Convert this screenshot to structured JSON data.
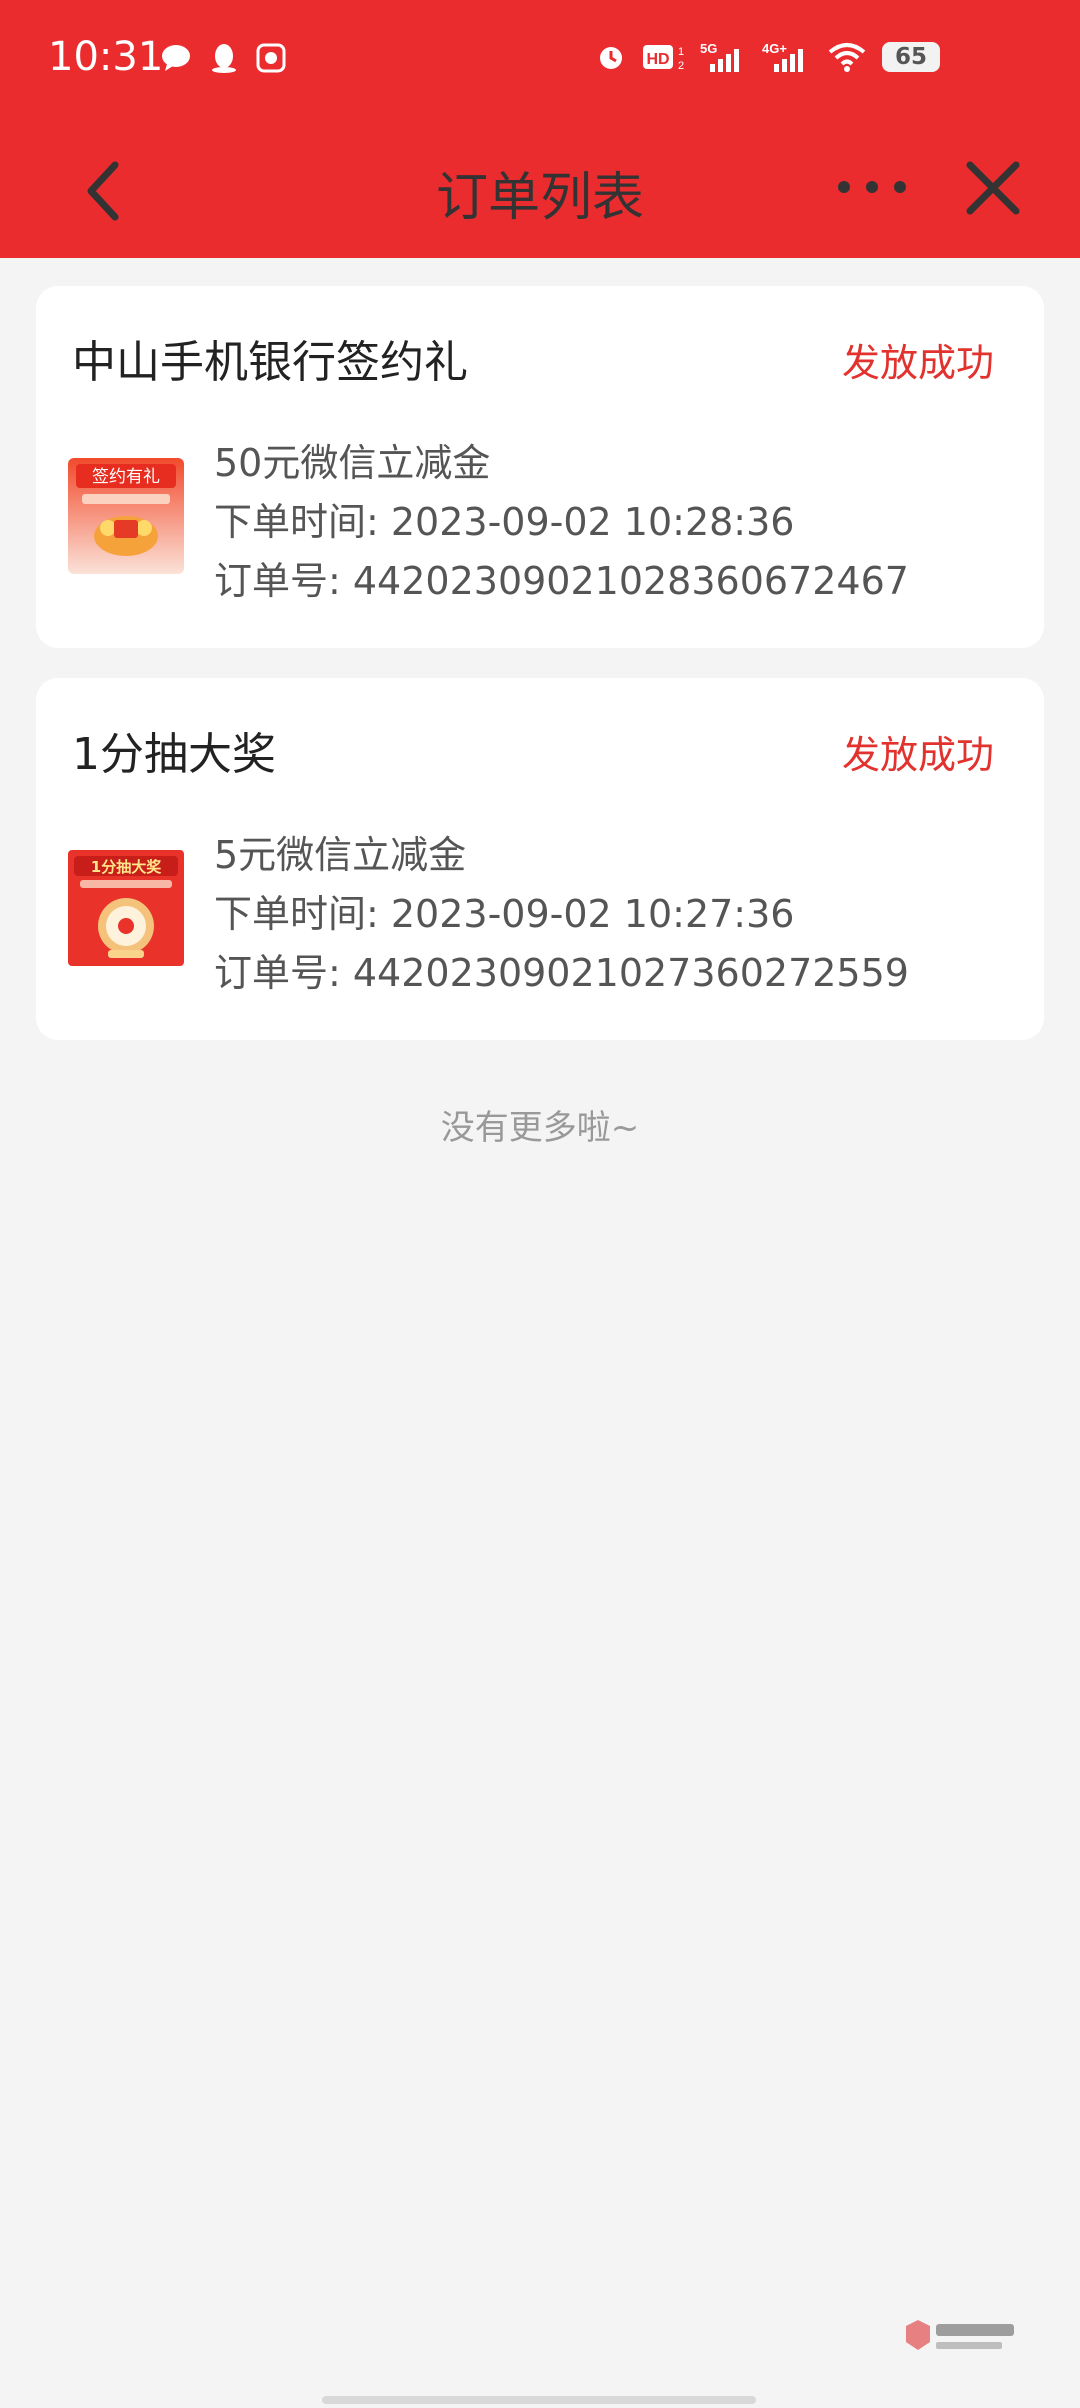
{
  "status_bar": {
    "time": "10:31",
    "battery": "65",
    "icons": [
      "chat-icon",
      "qq-penguin-icon",
      "app-badge-icon",
      "alarm-icon",
      "hd-icon",
      "5g-signal-icon",
      "4g-signal-icon",
      "wifi-icon"
    ]
  },
  "nav": {
    "title": "订单列表",
    "back_icon": "chevron-left-icon",
    "more_icon": "more-dots-icon",
    "close_icon": "close-icon"
  },
  "orders": [
    {
      "title": "中山手机银行签约礼",
      "status": "发放成功",
      "item_name": "50元微信立减金",
      "order_time": "下单时间: 2023-09-02 10:28:36",
      "order_no": "订单号: 442023090210283606​72467",
      "thumb_text": "签约有礼"
    },
    {
      "title": "1分抽大奖",
      "status": "发放成功",
      "item_name": "5元微信立减金",
      "order_time": "下单时间: 2023-09-02 10:27:36",
      "order_no": "订单号: 44202309021027360272559",
      "thumb_text": "1分抽大奖"
    }
  ],
  "footer": {
    "no_more": "没有更多啦~"
  },
  "colors": {
    "header_red": "#ea2c2f",
    "status_red": "#e1322e",
    "background": "#f4f4f4"
  }
}
